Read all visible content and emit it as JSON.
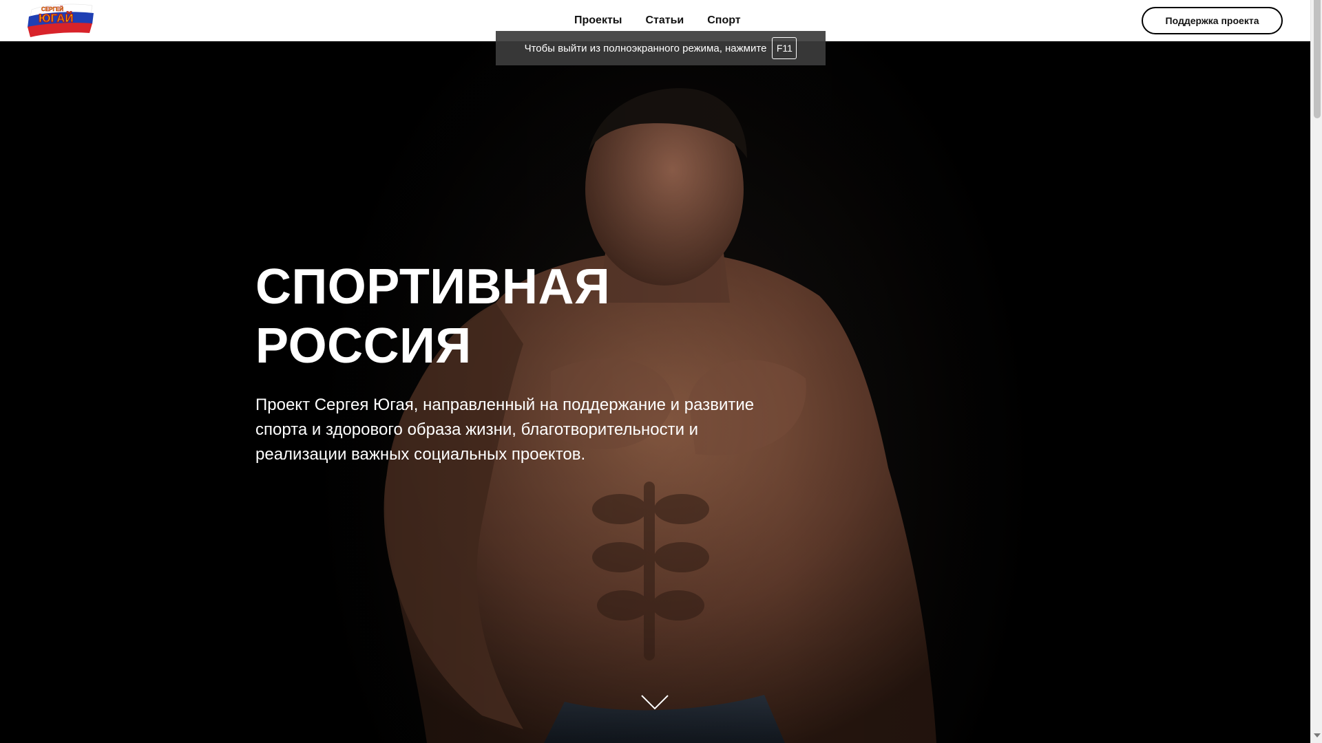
{
  "header": {
    "logo_icon": "russia-flag-brush-logo",
    "nav": [
      "Проекты",
      "Статьи",
      "Спорт"
    ],
    "support_button": "Поддержка проекта"
  },
  "hero": {
    "title_line1": "СПОРТИВНАЯ",
    "title_line2": "РОССИЯ",
    "description": "Проект Сергея Югая, направленный на поддержание и развитие спорта и здорового образа жизни, благотворительности и реализации важных социальных проектов.",
    "scroll_icon": "chevron-down-icon"
  },
  "fullscreen_notice": {
    "text": "Чтобы выйти из полноэкранного режима, нажмите",
    "key": "F11"
  },
  "colors": {
    "header_bg": "#ffffff",
    "hero_bg": "#000000",
    "text_light": "#ffffff",
    "text_dark": "#111111"
  }
}
